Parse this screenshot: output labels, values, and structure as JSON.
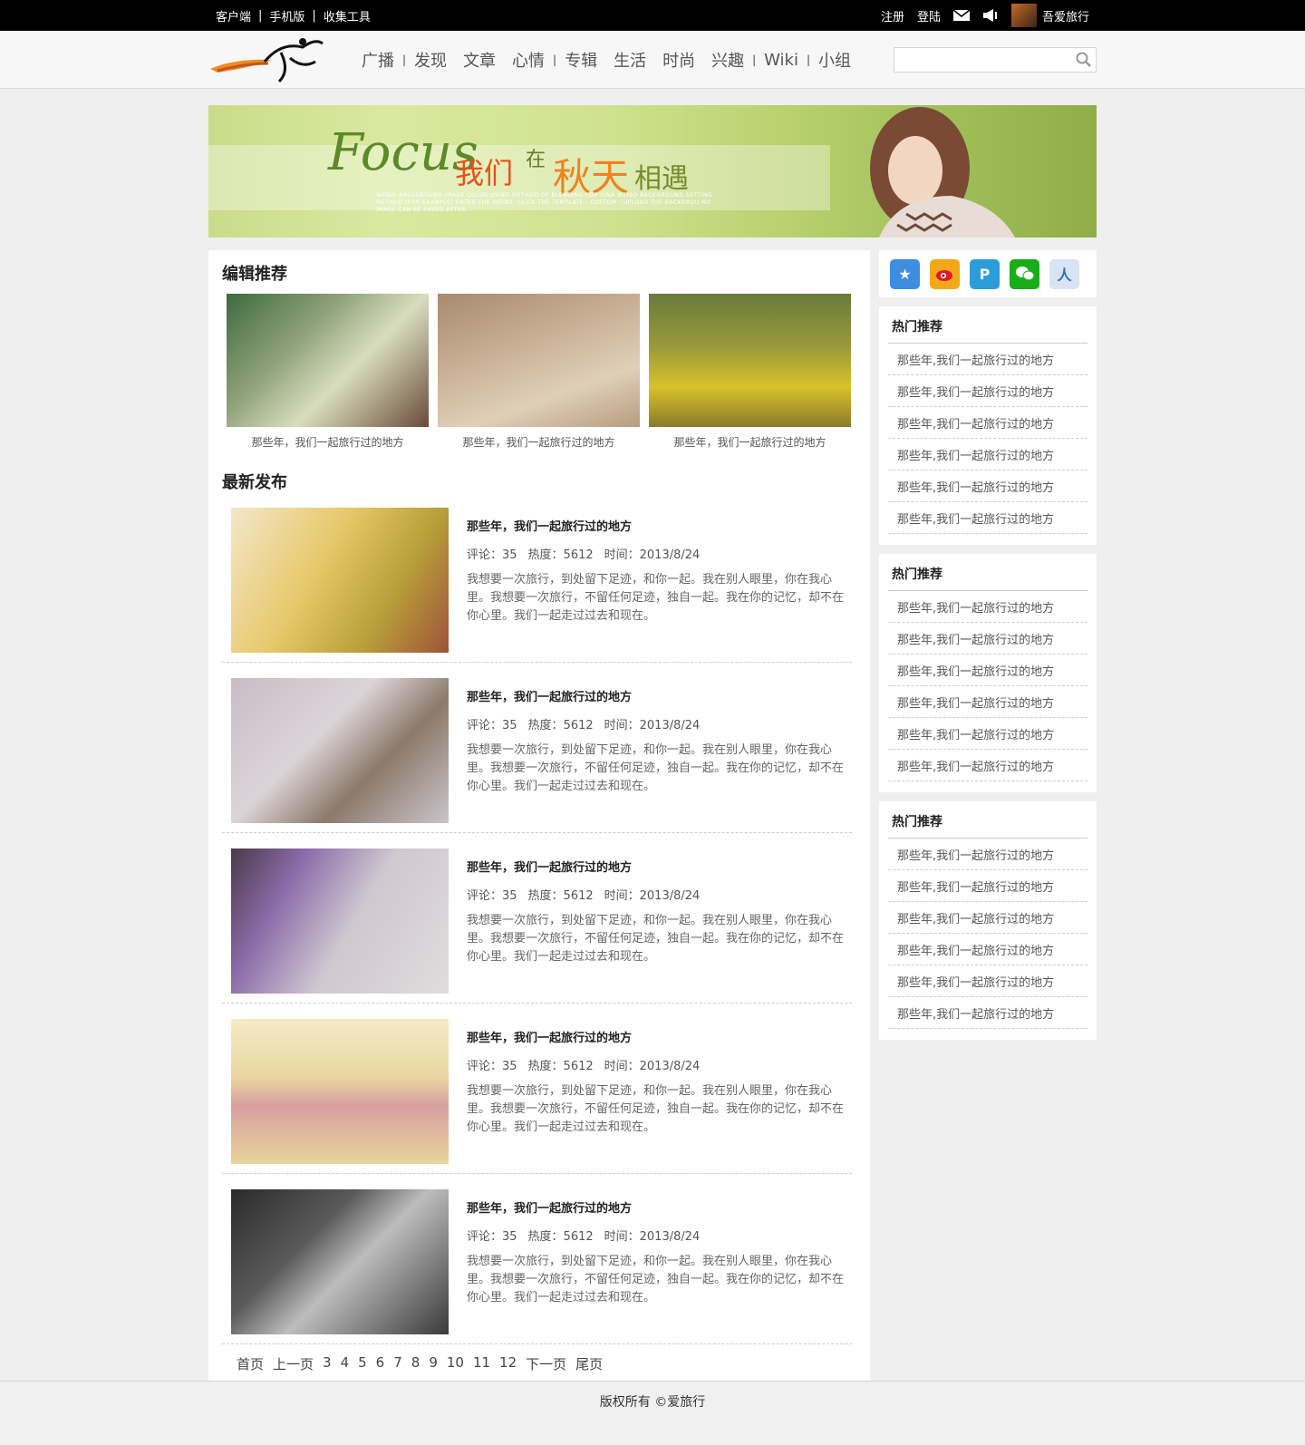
{
  "topbar": {
    "links": [
      "客户端",
      "手机版",
      "收集工具"
    ],
    "register": "注册",
    "login": "登陆",
    "username": "吾爱旅行"
  },
  "nav": [
    "广播",
    "发现",
    "文章",
    "心情",
    "专辑",
    "生活",
    "时尚",
    "兴趣",
    "Wiki",
    "小组"
  ],
  "search": {
    "placeholder": ""
  },
  "banner": {
    "focus": "Focus",
    "w1": "我们",
    "w2": "在",
    "w3": "秋天",
    "w4": "相遇",
    "sub": "WEIBO BACKGROUND IMAGE COLOR USING METHOD OF BLENDING FOR SINA WEIBO BACKGROUND SETTING METHOD (FOR EXAMPLE) ENTER THE WEIBO, CLICK THE TEMPLATE - CUSTOM - UPLOAD THE BACKGROU NO IMAGE CAN BE SAVED AFTER."
  },
  "editor_recs": {
    "title": "编辑推荐",
    "items": [
      "那些年，我们一起旅行过的地方",
      "那些年，我们一起旅行过的地方",
      "那些年，我们一起旅行过的地方"
    ]
  },
  "latest": {
    "title": "最新发布",
    "posts": [
      {
        "title": "那些年，我们一起旅行过的地方",
        "comments": "评论：35",
        "heat": "热度：5612",
        "time": "时间：2013/8/24",
        "desc": "我想要一次旅行，到处留下足迹，和你一起。我在别人眼里，你在我心里。我想要一次旅行，不留任何足迹，独自一起。我在你的记忆，却不在你心里。我们一起走过过去和现在。"
      },
      {
        "title": "那些年，我们一起旅行过的地方",
        "comments": "评论：35",
        "heat": "热度：5612",
        "time": "时间：2013/8/24",
        "desc": "我想要一次旅行，到处留下足迹，和你一起。我在别人眼里，你在我心里。我想要一次旅行，不留任何足迹，独自一起。我在你的记忆，却不在你心里。我们一起走过过去和现在。"
      },
      {
        "title": "那些年，我们一起旅行过的地方",
        "comments": "评论：35",
        "heat": "热度：5612",
        "time": "时间：2013/8/24",
        "desc": "我想要一次旅行，到处留下足迹，和你一起。我在别人眼里，你在我心里。我想要一次旅行，不留任何足迹，独自一起。我在你的记忆，却不在你心里。我们一起走过过去和现在。"
      },
      {
        "title": "那些年，我们一起旅行过的地方",
        "comments": "评论：35",
        "heat": "热度：5612",
        "time": "时间：2013/8/24",
        "desc": "我想要一次旅行，到处留下足迹，和你一起。我在别人眼里，你在我心里。我想要一次旅行，不留任何足迹，独自一起。我在你的记忆，却不在你心里。我们一起走过过去和现在。"
      },
      {
        "title": "那些年，我们一起旅行过的地方",
        "comments": "评论：35",
        "heat": "热度：5612",
        "time": "时间：2013/8/24",
        "desc": "我想要一次旅行，到处留下足迹，和你一起。我在别人眼里，你在我心里。我想要一次旅行，不留任何足迹，独自一起。我在你的记忆，却不在你心里。我们一起走过过去和现在。"
      }
    ]
  },
  "pager": [
    "首页",
    "上一页",
    "3",
    "4",
    "5",
    "6",
    "7",
    "8",
    "9",
    "10",
    "11",
    "12",
    "下一页",
    "尾页"
  ],
  "hot_blocks": [
    {
      "title": "热门推荐",
      "items": [
        "那些年,我们一起旅行过的地方",
        "那些年,我们一起旅行过的地方",
        "那些年,我们一起旅行过的地方",
        "那些年,我们一起旅行过的地方",
        "那些年,我们一起旅行过的地方",
        "那些年,我们一起旅行过的地方"
      ]
    },
    {
      "title": "热门推荐",
      "items": [
        "那些年,我们一起旅行过的地方",
        "那些年,我们一起旅行过的地方",
        "那些年,我们一起旅行过的地方",
        "那些年,我们一起旅行过的地方",
        "那些年,我们一起旅行过的地方",
        "那些年,我们一起旅行过的地方"
      ]
    },
    {
      "title": "热门推荐",
      "items": [
        "那些年,我们一起旅行过的地方",
        "那些年,我们一起旅行过的地方",
        "那些年,我们一起旅行过的地方",
        "那些年,我们一起旅行过的地方",
        "那些年,我们一起旅行过的地方",
        "那些年,我们一起旅行过的地方"
      ]
    }
  ],
  "share_icons": [
    {
      "name": "qzone-icon",
      "color": "#3d8ee0"
    },
    {
      "name": "weibo-icon",
      "color": "#e6162d"
    },
    {
      "name": "tencent-weibo-icon",
      "color": "#2a9ed8"
    },
    {
      "name": "wechat-icon",
      "color": "#1aad19"
    },
    {
      "name": "renren-icon",
      "color": "#2a6ebb"
    }
  ],
  "footer": "版权所有 ©爱旅行"
}
